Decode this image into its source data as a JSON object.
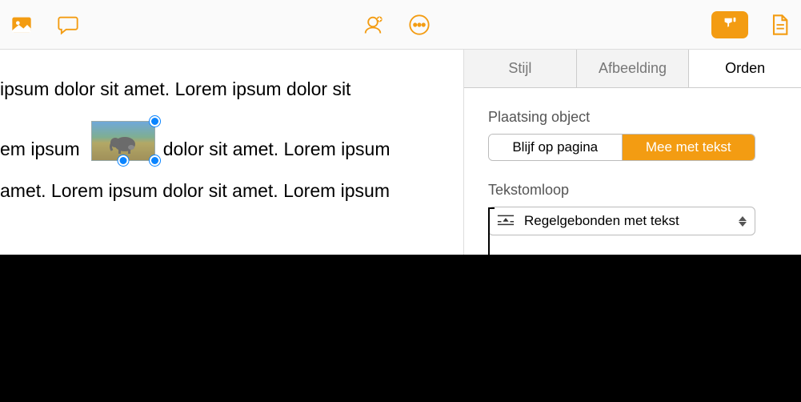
{
  "toolbar": {
    "media_icon": "image-icon",
    "comment_icon": "comment-icon",
    "collab_icon": "collaborate-icon",
    "more_icon": "more-icon",
    "format_icon": "format-brush-icon",
    "doc_icon": "document-icon"
  },
  "document": {
    "line1": " ipsum dolor sit amet.  Lorem ipsum dolor sit",
    "line2a": "em ipsum",
    "line2b": "dolor sit amet. Lorem ipsum",
    "line3": "amet. Lorem ipsum dolor sit amet. Lorem ipsum"
  },
  "inspector": {
    "tabs": [
      {
        "label": "Stijl",
        "active": false
      },
      {
        "label": "Afbeelding",
        "active": false
      },
      {
        "label": "Orden",
        "active": true
      }
    ],
    "placement": {
      "title": "Plaatsing object",
      "options": [
        {
          "label": "Blijf op pagina",
          "active": false
        },
        {
          "label": "Mee met tekst",
          "active": true
        }
      ]
    },
    "wrap": {
      "title": "Tekstomloop",
      "value": "Regelgebonden met tekst"
    }
  },
  "colors": {
    "accent": "#f39c12",
    "selection_handle": "#0a84ff"
  }
}
